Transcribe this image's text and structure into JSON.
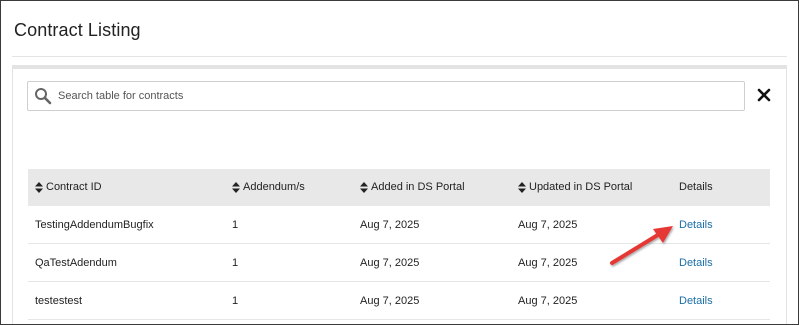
{
  "page": {
    "title": "Contract Listing"
  },
  "search": {
    "placeholder": "Search table for contracts",
    "value": ""
  },
  "table": {
    "headers": [
      "Contract ID",
      "Addendum/s",
      "Added in DS Portal",
      "Updated in DS Portal",
      "Details"
    ],
    "rows": [
      {
        "contract_id": "TestingAddendumBugfix",
        "addendums": "1",
        "added": "Aug 7, 2025",
        "updated": "Aug 7, 2025",
        "details": "Details"
      },
      {
        "contract_id": "QaTestAdendum",
        "addendums": "1",
        "added": "Aug 7, 2025",
        "updated": "Aug 7, 2025",
        "details": "Details"
      },
      {
        "contract_id": "testestest",
        "addendums": "1",
        "added": "Aug 7, 2025",
        "updated": "Aug 7, 2025",
        "details": "Details"
      }
    ]
  },
  "colors": {
    "link": "#1a6fa8",
    "header_bg": "#e8e8e8",
    "annotation_arrow": "#e53935"
  },
  "icons": {
    "search": "search-icon",
    "clear": "close-icon",
    "sort": "sort-icon"
  }
}
